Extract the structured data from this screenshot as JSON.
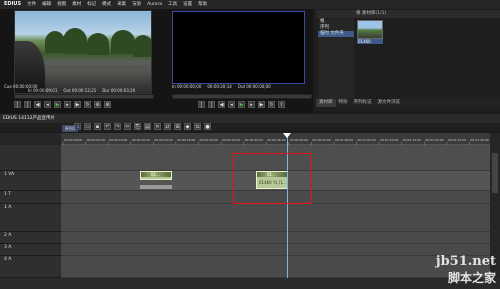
{
  "menu": {
    "logo": "EDIUS",
    "items": [
      "文件",
      "编辑",
      "视图",
      "素材",
      "标记",
      "模式",
      "采集",
      "渲染",
      "Aurora",
      "工具",
      "设置",
      "帮助"
    ]
  },
  "player": {
    "cue": "Cue 00:00:00;00",
    "in": "In 00:00:09;01",
    "out": "Out 00:00:12;21",
    "dur": "Dur 00:00:03;20"
  },
  "recorder": {
    "cue": "Cue 00:00:00;00",
    "in": "In 00:00:00;00",
    "out": "Out 00:00:00;00",
    "current": "00:00:20;14",
    "dur": "Dur 00:00:00;00"
  },
  "bin": {
    "header": "根 素材库(1/1)",
    "folders": [
      "根",
      "序列",
      "临时 文件夹"
    ],
    "clip_label": "01460"
  },
  "bin_tabs": [
    "素材库",
    "特效",
    "序列标记",
    "源文件浏览"
  ],
  "project": {
    "title": "EDIUS   14112产品宣传片",
    "sequence_tab": "序列1"
  },
  "ruler": {
    "ticks": [
      "00:00:00;00",
      "00:00:05;00",
      "00:00:10;00",
      "00:00:15;00",
      "00:00:20;00",
      "00:00:25;00",
      "00:00:30;00",
      "00:00:35;00",
      "00:00:40;00",
      "00:00:45;00",
      "00:00:50;00",
      "00:00:55;00",
      "00:01:00;00",
      "00:01:05;00",
      "00:01:10;00",
      "00:01:15;00",
      "00:01:20;00",
      "00:01:25;00",
      "00:01:30;00"
    ]
  },
  "tracks": [
    "1 VA",
    "1 T",
    "1 A",
    "2 A",
    "3 A",
    "4 A"
  ],
  "clips": {
    "clip1_label": "01...",
    "clip2_label": "01...",
    "clip2_body": "01460 YL [1..."
  },
  "watermark": {
    "line1": "jb51.net",
    "line2": "脚本之家"
  }
}
